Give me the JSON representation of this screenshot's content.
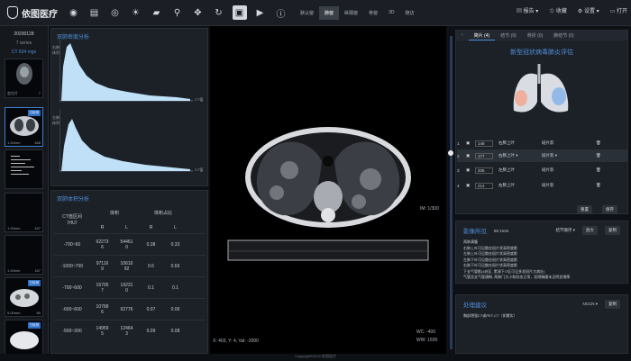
{
  "app": {
    "name": "依图医疗"
  },
  "modes": [
    "默认窗",
    "肺窗",
    "纵隔窗",
    "骨窗",
    "3D",
    "随访"
  ],
  "topright": {
    "report": "报告 ▾",
    "collect": "收藏",
    "settings": "设置 ▾",
    "open": "打开"
  },
  "study": {
    "date": "20200128",
    "series": "7 series",
    "dose": "CT 634 mgs"
  },
  "thumbs": [
    {
      "label": "定位片",
      "count": "7",
      "tag": ""
    },
    {
      "label": "1.00mm",
      "count": "468",
      "tag": "已检测"
    },
    {
      "label": "",
      "count": "",
      "tag": ""
    },
    {
      "label": "1.00mm",
      "count": "167",
      "tag": ""
    },
    {
      "label": "1.00mm",
      "count": "167",
      "tag": ""
    },
    {
      "label": "5.00mm",
      "count": "85",
      "tag": "已检测"
    },
    {
      "label": "1.00mm",
      "count": "468",
      "tag": "已检测"
    }
  ],
  "density": {
    "title": "双肺密度分析",
    "chart1_ylabel": "右肺\n体积",
    "chart2_ylabel": "左肺\n体积",
    "xlabel": "CT值"
  },
  "volume": {
    "title": "双肺体积分析",
    "header": {
      "range": "CT值区间\n（HU）",
      "vol": "体积",
      "pct": "体积占比",
      "r": "R",
      "l": "L"
    },
    "rows": [
      [
        "-700~60",
        "62273\n6",
        "54461\n0",
        "0.38",
        "0.33"
      ],
      [
        "-1000~700",
        "97116\n9",
        "10616\n92",
        "0.6",
        "0.66"
      ],
      [
        "-700~600",
        "16705\n7",
        "19231\n0",
        "0.1",
        "0.1"
      ],
      [
        "-600~600",
        "10768\n6",
        "92776",
        "0.07",
        "0.06"
      ],
      [
        "-500~300",
        "14959\n5",
        "12464\n3",
        "0.09",
        "0.08"
      ]
    ]
  },
  "viewer": {
    "coords": "X: 403, Y: 4, Val: -2000",
    "wc": "WC: -400",
    "ww": "WW: 1500",
    "m": "IM: 1/300"
  },
  "footer": "Copyright©2020 依图医疗",
  "right": {
    "tabs": [
      "简片 (4)",
      "结节 (9)",
      "骨折 (0)",
      "肺结节 (0)"
    ],
    "title": "新型冠状病毒肺炎评估",
    "items": [
      [
        "1",
        "148",
        "右肺上叶",
        "斑片影"
      ],
      [
        "2",
        "177",
        "右肺上叶 ▾",
        "斑片影 ▾"
      ],
      [
        "3",
        "206",
        "左肺上叶",
        "斑片影"
      ],
      [
        "4",
        "214",
        "右肺上叶",
        "斑片影"
      ]
    ],
    "reset": "重置",
    "save": "保存"
  },
  "report": {
    "title": "影像所见",
    "m": "IM 1mm",
    "sort": "结节顺序 ▾",
    "zoom": "放大",
    "copy": "复制",
    "lines": [
      "两肺满腹",
      "右肺上叶可见散在斑片状高密度影",
      "左肺上叶可见散在斑片状高密度影",
      "左肺下叶可见散在斑片状高密度影",
      "右肺下叶可见散在斑片状高密度影",
      "下支气管影(4处区, 累演下/7区可见多发斑片大病灶)",
      "气管及支气管通畅, 两肺门大小和形态正常，双侧胸膜未见明显增厚"
    ]
  },
  "advice": {
    "title": "处理建议",
    "ncc": "NCCN ▾",
    "copy": "复制",
    "text": "胸部增强CT或PET-CT（如需实）"
  }
}
